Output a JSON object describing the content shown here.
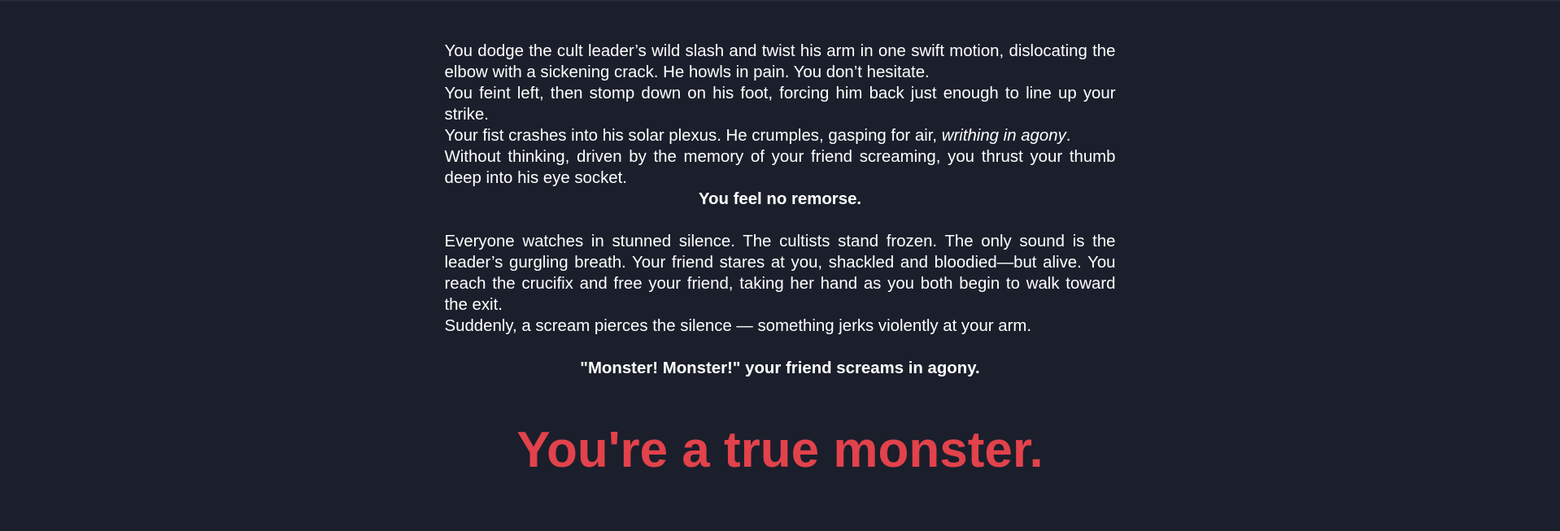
{
  "colors": {
    "background": "#1a1f2b",
    "text": "#ffffff",
    "accent_red": "#e2424b"
  },
  "story": {
    "p1": "You dodge the cult leader’s wild slash and twist his arm in one swift motion, dislocating the elbow with a sickening crack. He howls in pain. You don’t hesitate.",
    "p2": "You feint left, then stomp down on his foot, forcing him back just enough to line up your strike.",
    "p3_before": "Your fist crashes into his solar plexus. He crumples, gasping for air, ",
    "p3_italic": "writhing in agony",
    "p3_after": ".",
    "p4": "Without thinking, driven by the memory of your friend screaming, you thrust your thumb deep into his eye socket.",
    "no_remorse": "You feel no remorse.",
    "p5": "Everyone watches in stunned silence. The cultists stand frozen. The only sound is the leader’s gurgling breath. Your friend stares at you, shackled and bloodied—but alive. You reach the crucifix and free your friend, taking her hand as you both begin to walk toward the exit.",
    "p6": "Suddenly, a scream pierces the silence — something jerks violently at your arm.",
    "friend_scream": "\"Monster! Monster!\" your friend screams in agony.",
    "ending_title": "You're a true monster."
  }
}
